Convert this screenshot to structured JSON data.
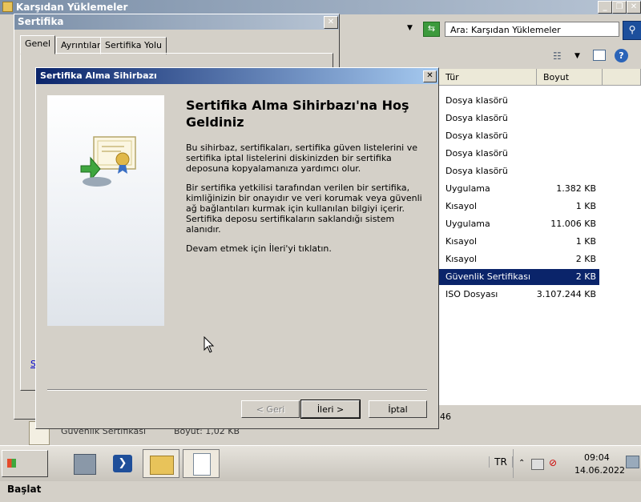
{
  "explorer": {
    "title": "Karşıdan Yüklemeler",
    "search_placeholder": "Ara: Karşıdan Yüklemeler",
    "columns": {
      "type": "Tür",
      "size": "Boyut"
    },
    "rows": [
      {
        "type": "Dosya klasörü",
        "size": ""
      },
      {
        "type": "Dosya klasörü",
        "size": ""
      },
      {
        "type": "Dosya klasörü",
        "size": ""
      },
      {
        "type": "Dosya klasörü",
        "size": ""
      },
      {
        "type": "Dosya klasörü",
        "size": ""
      },
      {
        "type": "Uygulama",
        "size": "1.382 KB"
      },
      {
        "type": "Kısayol",
        "size": "1 KB"
      },
      {
        "type": "Uygulama",
        "size": "11.006 KB"
      },
      {
        "type": "Kısayol",
        "size": "1 KB"
      },
      {
        "type": "Kısayol",
        "size": "2 KB"
      },
      {
        "type": "Güvenlik Sertifikası",
        "size": "2 KB",
        "selected": true
      },
      {
        "type": "ISO Dosyası",
        "size": "3.107.244 KB"
      }
    ],
    "status": {
      "item_name": "Güvenlik Sertifikası",
      "item_size": "Boyut: 1,02 KB",
      "count_fragment": "46"
    }
  },
  "cert_dialog": {
    "title": "Sertifika",
    "tabs": [
      "Genel",
      "Ayrıntılar",
      "Sertifika Yolu"
    ],
    "link_fragment": "Se"
  },
  "wizard": {
    "title": "Sertifika Alma Sihirbazı",
    "heading": "Sertifika Alma Sihirbazı'na Hoş Geldiniz",
    "para1": "Bu sihirbaz, sertifikaları, sertifika güven listelerini ve sertifika iptal listelerini diskinizden bir sertifika deposuna kopyalamanıza yardımcı olur.",
    "para2": "Bir sertifika yetkilisi tarafından verilen bir sertifika, kimliğinizin bir onayıdır ve veri korumak veya güvenli ağ bağlantıları kurmak için kullanılan bilgiyi içerir. Sertifika deposu sertifikaların saklandığı sistem alanıdır.",
    "para3": "Devam etmek için İleri'yi tıklatın.",
    "buttons": {
      "back": "< Geri",
      "next": "İleri >",
      "cancel": "İptal"
    }
  },
  "taskbar": {
    "start": "Başlat",
    "lang": "TR",
    "time": "09:04",
    "date": "14.06.2022"
  }
}
